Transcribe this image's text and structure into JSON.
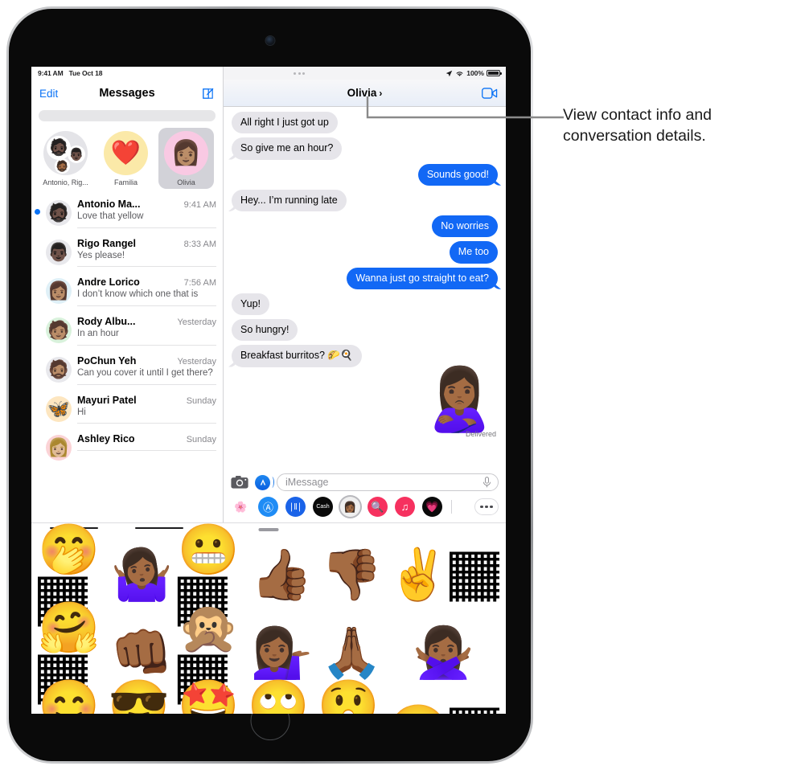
{
  "annotation": {
    "text": "View contact info and conversation details."
  },
  "status_bar": {
    "time": "9:41 AM",
    "date": "Tue Oct 18",
    "battery_percent": "100%",
    "location_icon": "location-arrow-icon",
    "wifi_icon": "wifi-icon",
    "battery_icon": "battery-full-icon",
    "multitask_icon": "multitask-handle-icon"
  },
  "sidebar": {
    "edit_label": "Edit",
    "title": "Messages",
    "compose_icon": "compose-icon",
    "search_placeholder": "",
    "pinned": [
      {
        "label": "Antonio, Rig...",
        "kind": "group",
        "faces": [
          "🧔🏿",
          "👨🏿",
          "🧔🏾"
        ],
        "selected": false
      },
      {
        "label": "Familia",
        "kind": "emoji",
        "glyph": "❤️",
        "bg": "#fbe9a8",
        "selected": false
      },
      {
        "label": "Olivia",
        "kind": "memoji",
        "glyph": "👩🏽",
        "bg": "#f9c9e3",
        "selected": true
      }
    ],
    "conversations": [
      {
        "name": "Antonio Ma...",
        "time": "9:41 AM",
        "preview": "Love that yellow",
        "unread": true,
        "glyph": "🧔🏿",
        "bg": "#e8e8ec"
      },
      {
        "name": "Rigo Rangel",
        "time": "8:33 AM",
        "preview": "Yes please!",
        "unread": false,
        "glyph": "👨🏿",
        "bg": "#e8e8ec"
      },
      {
        "name": "Andre Lorico",
        "time": "7:56 AM",
        "preview": "I don’t know which one that is",
        "unread": false,
        "glyph": "👩🏽",
        "bg": "#dff0f7"
      },
      {
        "name": "Rody Albu...",
        "time": "Yesterday",
        "preview": "In an hour",
        "unread": false,
        "glyph": "🧑🏽",
        "bg": "#d9f2dc"
      },
      {
        "name": "PoChun Yeh",
        "time": "Yesterday",
        "preview": "Can you cover it until I get there?",
        "unread": false,
        "glyph": "🧔🏽",
        "bg": "#e8e8ec"
      },
      {
        "name": "Mayuri Patel",
        "time": "Sunday",
        "preview": "Hi",
        "unread": false,
        "glyph": "🦋",
        "bg": "#fde6c0"
      },
      {
        "name": "Ashley Rico",
        "time": "Sunday",
        "preview": "",
        "unread": false,
        "glyph": "👩🏼",
        "bg": "#fbd3d6"
      }
    ]
  },
  "conversation": {
    "title": "Olivia",
    "chevron": "›",
    "facetime_icon": "facetime-video-icon",
    "messages": [
      {
        "text": "All right I just got up",
        "side": "in",
        "tail": false
      },
      {
        "text": "So give me an hour?",
        "side": "in",
        "tail": true
      },
      {
        "text": "Sounds good!",
        "side": "out",
        "tail": true
      },
      {
        "text": "Hey... I’m running late",
        "side": "in",
        "tail": true
      },
      {
        "text": "No worries",
        "side": "out",
        "tail": false
      },
      {
        "text": "Me too",
        "side": "out",
        "tail": false
      },
      {
        "text": "Wanna just go straight to eat?",
        "side": "out",
        "tail": true
      },
      {
        "text": "Yup!",
        "side": "in",
        "tail": false
      },
      {
        "text": "So hungry!",
        "side": "in",
        "tail": false
      },
      {
        "text": "Breakfast burritos? 🌮🍳",
        "side": "in",
        "tail": true
      }
    ],
    "sticker": {
      "glyph": "🙎🏾‍♀️",
      "status": "Delivered"
    },
    "input": {
      "placeholder": "iMessage",
      "value": "",
      "camera_icon": "camera-icon",
      "appstore_icon": "app-store-icon",
      "mic_icon": "microphone-icon"
    },
    "app_drawer": [
      {
        "name": "photos",
        "glyph": "🌸",
        "bg": "#ffffff",
        "selected": false
      },
      {
        "name": "app-store",
        "glyph": "Ⓐ",
        "bg": "#1f8cf5",
        "selected": false
      },
      {
        "name": "voice-audio",
        "glyph": "∣‖∣",
        "bg": "#1a63e8",
        "selected": false
      },
      {
        "name": "apple-cash",
        "glyph": "Cash",
        "bg": "#0a0a0a",
        "selected": false
      },
      {
        "name": "memoji",
        "glyph": "👩🏾",
        "bg": "#efefef",
        "selected": true
      },
      {
        "name": "images-gif",
        "glyph": "🔍",
        "bg": "#f6315f",
        "selected": false
      },
      {
        "name": "music",
        "glyph": "♫",
        "bg": "#f6315f",
        "selected": false
      },
      {
        "name": "digital-touch",
        "glyph": "💗",
        "bg": "#0a0a0a",
        "selected": false
      }
    ],
    "more_label": "•••"
  },
  "sticker_tray": {
    "grabber": "drag-handle",
    "stickers": [
      "🤭🏾",
      "🤷🏾‍♀️",
      "😬🏾",
      "👍🏾",
      "👎🏾",
      "✌️🏾",
      "🤗🏾",
      "👊🏾",
      "🙊🏾",
      "💁🏾‍♀️",
      "🙏🏾",
      "🙅🏾‍♀️",
      "😊🏾",
      "😎🏾",
      "🤩🏾",
      "🙄🏾",
      "😲🏾",
      "😆🏾"
    ]
  },
  "colors": {
    "imessage_blue": "#1268f5",
    "bubble_gray": "#e6e5ea",
    "tint": "#0a72f5",
    "unread_dot": "#0a72f5"
  }
}
